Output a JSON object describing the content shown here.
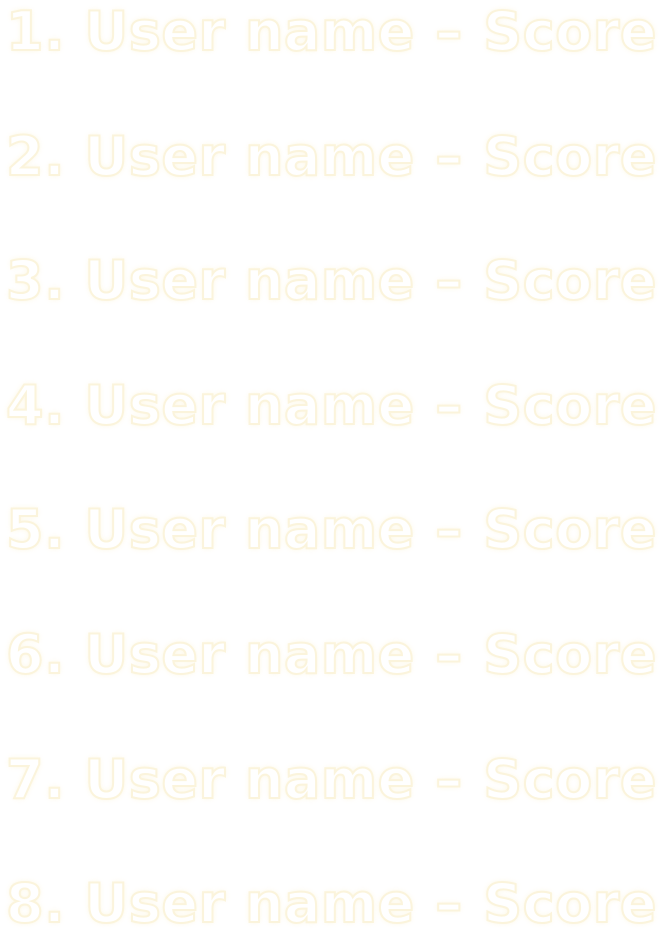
{
  "leaderboard": {
    "entries": [
      {
        "rank": "1.",
        "name": "User name",
        "dash": "–",
        "score": "Score"
      },
      {
        "rank": "2.",
        "name": "User name",
        "dash": "–",
        "score": "Score"
      },
      {
        "rank": "3.",
        "name": "User name",
        "dash": "–",
        "score": "Score"
      },
      {
        "rank": "4.",
        "name": "User name",
        "dash": "–",
        "score": "Score"
      },
      {
        "rank": "5.",
        "name": "User name",
        "dash": "–",
        "score": "Score"
      },
      {
        "rank": "6.",
        "name": "User name",
        "dash": "–",
        "score": "Score"
      },
      {
        "rank": "7.",
        "name": "User name",
        "dash": "–",
        "score": "Score"
      },
      {
        "rank": "8.",
        "name": "User name",
        "dash": "–",
        "score": "Score"
      }
    ]
  },
  "colors": {
    "text_fill": "#ffffff",
    "text_outline": "#fbf4dc",
    "background": "#ffffff"
  }
}
